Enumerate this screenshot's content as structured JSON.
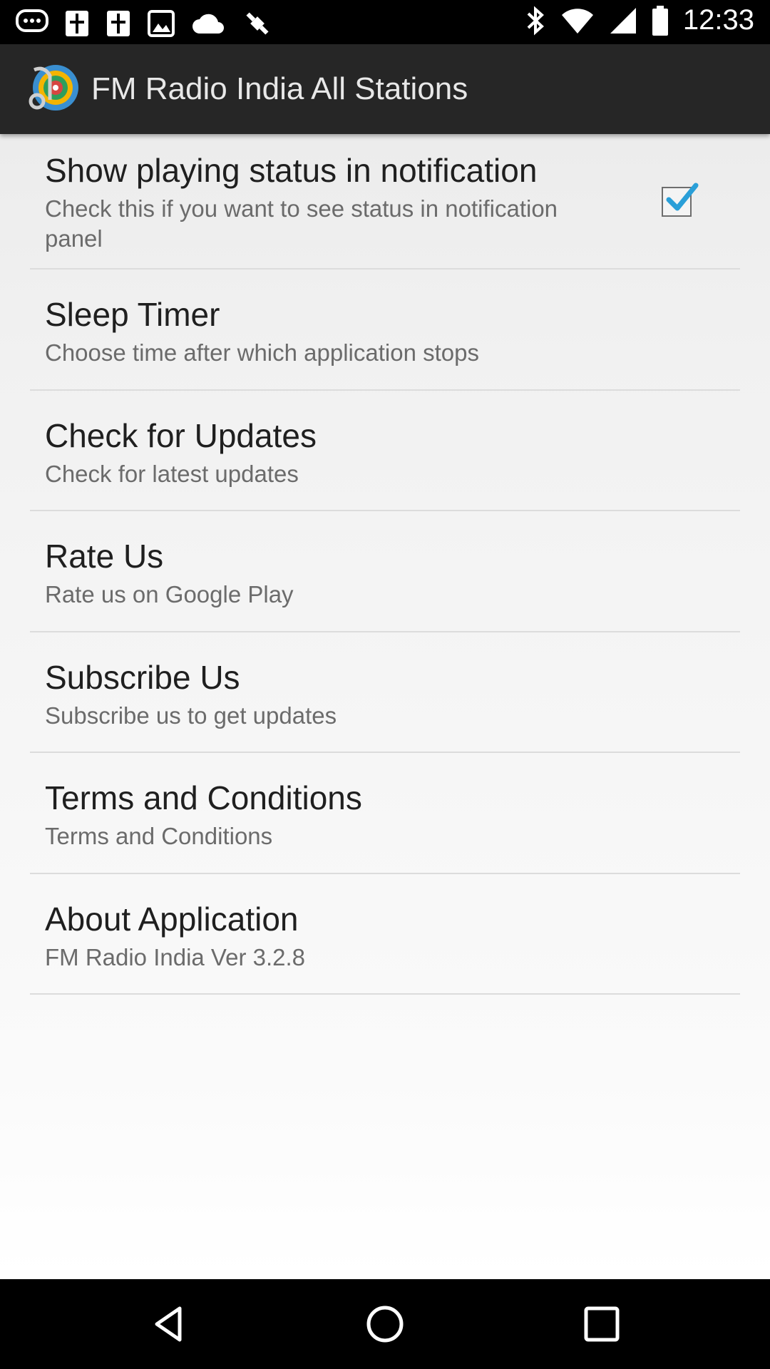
{
  "status_bar": {
    "time": "12:33",
    "left_icons": [
      "chat-bubble-icon",
      "phone-icon",
      "phone-icon",
      "image-icon",
      "cloud-icon",
      "fake-gps-icon"
    ],
    "right_icons": [
      "bluetooth-icon",
      "wifi-icon",
      "signal-icon",
      "battery-icon"
    ]
  },
  "app_bar": {
    "title": "FM Radio India All Stations",
    "icon": "radio-app-icon"
  },
  "settings": [
    {
      "title": "Show playing status in notification",
      "summary": "Check this if you want to see status in notification panel",
      "checkbox": true,
      "checked": true
    },
    {
      "title": "Sleep Timer",
      "summary": "Choose time after which application stops"
    },
    {
      "title": "Check for Updates",
      "summary": "Check for latest updates"
    },
    {
      "title": "Rate Us",
      "summary": "Rate us on Google Play"
    },
    {
      "title": "Subscribe Us",
      "summary": "Subscribe us to get updates"
    },
    {
      "title": "Terms and Conditions",
      "summary": "Terms and Conditions"
    },
    {
      "title": "About Application",
      "summary": "FM Radio India Ver 3.2.8"
    }
  ],
  "nav_bar": [
    "back-icon",
    "home-icon",
    "recents-icon"
  ],
  "colors": {
    "checkbox_check": "#2a9fd8",
    "app_bar": "#262626"
  }
}
